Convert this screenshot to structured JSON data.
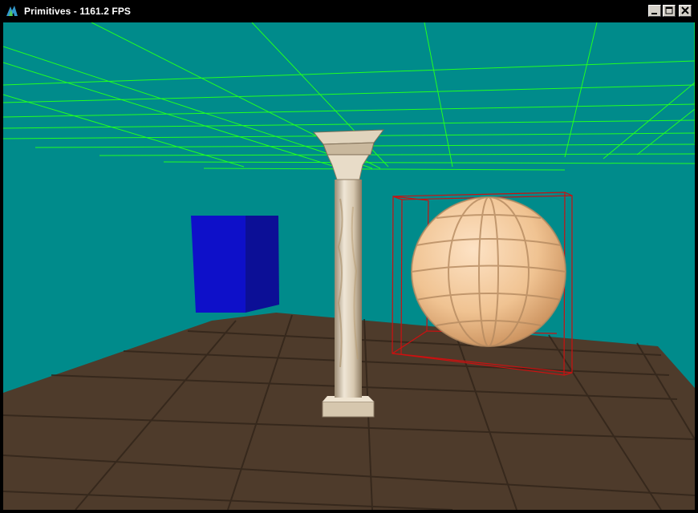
{
  "window": {
    "title": "Primitives - 1161.2 FPS"
  },
  "controls": {
    "minimize_icon": "minimize-icon",
    "maximize_icon": "maximize-icon",
    "close_icon": "close-icon"
  },
  "scene": {
    "background_color": "#008b8b",
    "ceiling_grid_color": "#22ff22",
    "cube_color": "#1010cc",
    "bounding_box_color": "#cc1010",
    "floor_color": "#4a3828"
  }
}
